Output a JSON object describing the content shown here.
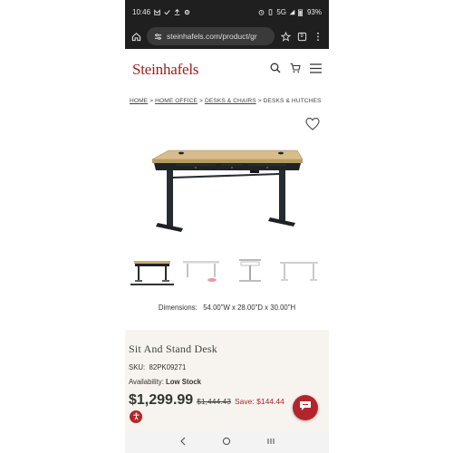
{
  "status": {
    "time": "10:46",
    "network": "5G",
    "battery": "93%"
  },
  "browser": {
    "url": "steinhafels.com/product/gr",
    "tab_count": "9"
  },
  "site": {
    "logo": "Steinhafels"
  },
  "breadcrumb": [
    "HOME",
    "HOME OFFICE",
    "DESKS & CHAIRS",
    "DESKS & HUTCHES"
  ],
  "product": {
    "dimensions": "Dimensions:   54.00\"W x 28.00\"D x 30.00\"H",
    "title": "Sit And Stand Desk",
    "sku": "SKU:  82PK09271",
    "availability_label": "Availability: ",
    "availability_value": "Low Stock",
    "price": "$1,299.99",
    "original_price": "$1,444.43",
    "savings": "Save: $144.44"
  },
  "thumbnails": [
    {
      "name": "desk-front",
      "active": true
    },
    {
      "name": "desk-white-base",
      "active": false
    },
    {
      "name": "desk-side",
      "active": false
    },
    {
      "name": "desk-frame",
      "active": false
    }
  ],
  "colors": {
    "brand": "#9b1c1c",
    "accent_button": "#b2262b",
    "info_bg": "#f7f4ef",
    "chrome_bg": "#1f1f1f"
  },
  "icons": [
    "home-icon",
    "site-settings-icon",
    "bookmark-star-icon",
    "tabs-icon",
    "more-icon",
    "search-icon",
    "cart-icon",
    "menu-icon",
    "heart-icon",
    "chat-icon",
    "accessibility-icon",
    "back-icon",
    "home-nav-icon",
    "recents-icon"
  ]
}
